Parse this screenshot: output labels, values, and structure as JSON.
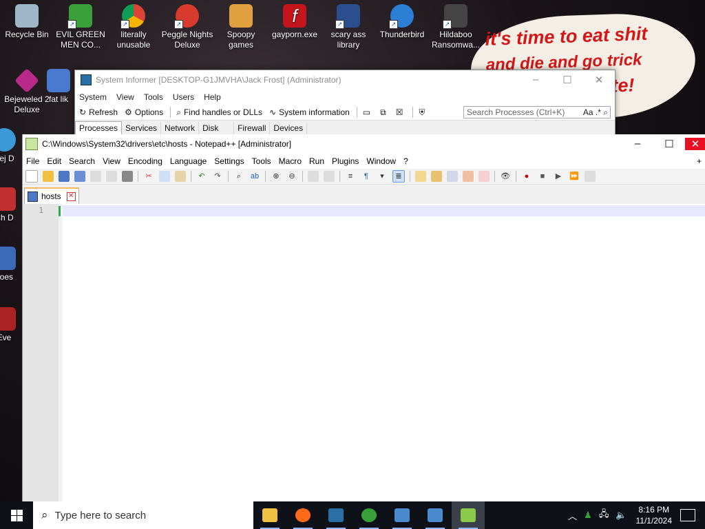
{
  "desktop": {
    "icons": [
      {
        "label": "Recycle Bin",
        "color": "#9fb6c9"
      },
      {
        "label": "EVIL GREEN MEN CO...",
        "color": "#3aa13a"
      },
      {
        "label": "literally unusable",
        "color": "#e8a21b"
      },
      {
        "label": "Peggle Nights Deluxe",
        "color": "#d83b2d"
      },
      {
        "label": "Spoopy games",
        "color": "#e0a040"
      },
      {
        "label": "gayporn.exe",
        "color": "#c4141c"
      },
      {
        "label": "scary ass library",
        "color": "#2a4f8c"
      },
      {
        "label": "Thunderbird",
        "color": "#2d7fd6"
      },
      {
        "label": "Hildaboo Ransomwa...",
        "color": "#444444"
      },
      {
        "label": "Bejeweled 2 Deluxe",
        "color": "#b72a8a"
      },
      {
        "label": "fat lik",
        "color": "#4a7ad0"
      },
      {
        "label": "Bej D",
        "color": "#3a9ad8"
      },
      {
        "label": "Ch D",
        "color": "#c43030"
      },
      {
        "label": "does",
        "color": "#3a6ab8"
      },
      {
        "label": "Eve",
        "color": "#aa2222"
      }
    ],
    "speech_bubble": [
      "it's time to eat shit",
      "and die and go trick",
      "vote!"
    ]
  },
  "system_informer": {
    "title": "System Informer [DESKTOP-G1JMVHA\\Jack Frost] (Administrator)",
    "menu": [
      "System",
      "View",
      "Tools",
      "Users",
      "Help"
    ],
    "toolbar": {
      "refresh": "Refresh",
      "options": "Options",
      "find_handles": "Find handles or DLLs",
      "system_information": "System information"
    },
    "search_placeholder": "Search Processes (Ctrl+K)",
    "search_options": "Aa .* ⌕",
    "tabs": [
      "Processes",
      "Services",
      "Network",
      "Disk",
      "Firewall",
      "Devices"
    ]
  },
  "notepad": {
    "title": "C:\\Windows\\System32\\drivers\\etc\\hosts - Notepad++ [Administrator]",
    "menu": [
      "File",
      "Edit",
      "Search",
      "View",
      "Encoding",
      "Language",
      "Settings",
      "Tools",
      "Macro",
      "Run",
      "Plugins",
      "Window",
      "?"
    ],
    "plus": "+",
    "tab_label": "hosts",
    "line_number": "1"
  },
  "taskbar": {
    "search_placeholder": "Type here to search",
    "time": "8:16 PM",
    "date": "11/1/2024",
    "apps": [
      {
        "name": "file-explorer",
        "color": "#f0c040"
      },
      {
        "name": "firefox",
        "color": "#ff6a1a"
      },
      {
        "name": "system-informer",
        "color": "#2a6ea8"
      },
      {
        "name": "evil-green-men",
        "color": "#3aa13a"
      },
      {
        "name": "remote-desktop-1",
        "color": "#4a8ad0"
      },
      {
        "name": "remote-desktop-2",
        "color": "#4a8ad0"
      },
      {
        "name": "notepad-plus-plus",
        "color": "#8cc84b"
      }
    ]
  }
}
